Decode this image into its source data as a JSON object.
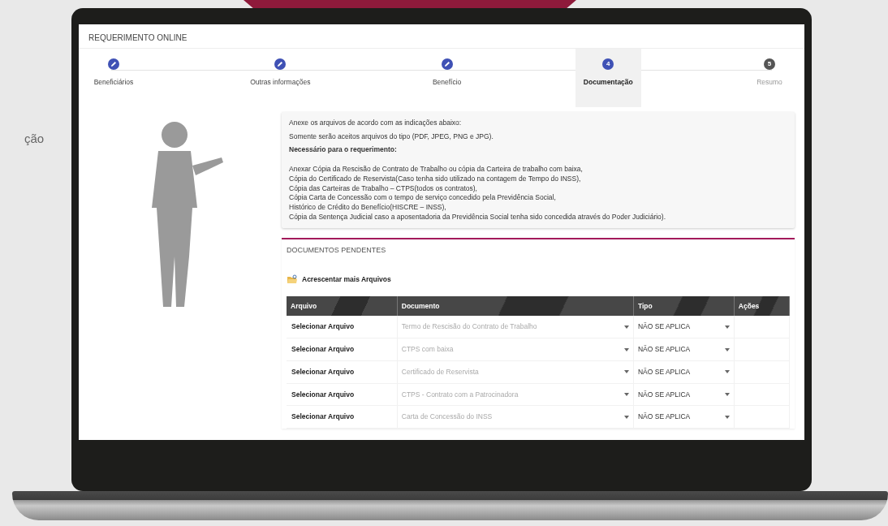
{
  "backdrop_text": "ção",
  "app": {
    "title": "REQUERIMENTO ONLINE",
    "steps": [
      {
        "label": "Beneficiários",
        "completed": true,
        "selected": false
      },
      {
        "label": "Outras informações",
        "completed": true,
        "selected": false
      },
      {
        "label": "Benefício",
        "completed": true,
        "selected": false
      },
      {
        "number": "4",
        "label": "Documentação",
        "completed": false,
        "selected": true
      },
      {
        "number": "5",
        "label": "Resumo",
        "completed": false,
        "selected": false
      }
    ],
    "instructions": {
      "intro": "Anexe os arquivos de acordo com as indicações abaixo:",
      "formats": "Somente serão aceitos arquivos do tipo (PDF, JPEG, PNG e JPG).",
      "heading": "Necessário para o requerimento:",
      "lines": [
        "Anexar Cópia da Rescisão de Contrato de Trabalho ou cópia da Carteira de trabalho com baixa,",
        "Cópia do Certificado de Reservista(Caso tenha sido utilizado na contagem de Tempo do INSS),",
        "Cópia das Carteiras de Trabalho – CTPS(todos os contratos),",
        "Cópia Carta de Concessão com o tempo de serviço concedido pela Previdência Social,",
        "Histórico de Crédito do Benefício(HISCRE – INSS),",
        "Cópia da Sentença Judicial caso a aposentadoria da Previdência Social tenha sido concedida através do Poder Judiciário)."
      ]
    },
    "pending": {
      "title": "DOCUMENTOS PENDENTES",
      "add_link": "Acrescentar mais Arquivos",
      "table": {
        "columns": [
          "Arquivo",
          "Documento",
          "Tipo",
          "Ações"
        ],
        "rows": [
          {
            "file": "Selecionar Arquivo",
            "document": {
              "placeholder": "Termo de Rescisão do Contrato de Trabalho"
            },
            "type": "NÃO SE APLICA"
          },
          {
            "file": "Selecionar Arquivo",
            "document": {
              "placeholder": "CTPS com baixa"
            },
            "type": "NÃO SE APLICA"
          },
          {
            "file": "Selecionar Arquivo",
            "document": {
              "placeholder": "Certificado de Reservista"
            },
            "type": "NÃO SE APLICA"
          },
          {
            "file": "Selecionar Arquivo",
            "document": {
              "placeholder": "CTPS - Contrato com a Patrocinadora"
            },
            "type": "NÃO SE APLICA"
          },
          {
            "file": "Selecionar Arquivo",
            "document": {
              "placeholder": "Carta de Concessão do INSS"
            },
            "type": "NÃO SE APLICA"
          }
        ]
      }
    }
  }
}
